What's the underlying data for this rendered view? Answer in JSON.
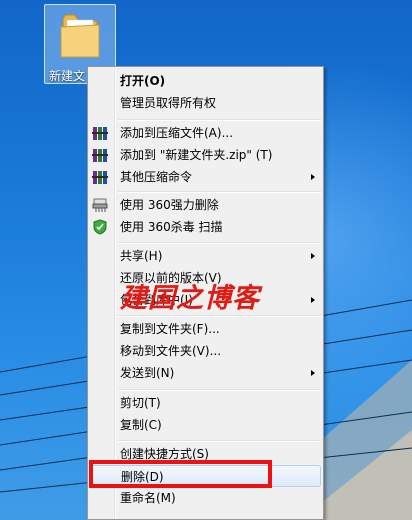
{
  "desktop": {
    "icon_label": "新建文"
  },
  "menu": {
    "items": [
      {
        "label": "打开(O)",
        "bold": true
      },
      {
        "label": "管理员取得所有权"
      },
      {
        "label": "添加到压缩文件(A)...",
        "icon": "winrar-icon"
      },
      {
        "label": "添加到 \"新建文件夹.zip\" (T)",
        "icon": "winrar-icon"
      },
      {
        "label": "其他压缩命令",
        "icon": "winrar-icon",
        "submenu": true
      },
      {
        "label": "使用 360强力删除",
        "icon": "shredder-icon"
      },
      {
        "label": "使用 360杀毒 扫描",
        "icon": "shield-icon"
      },
      {
        "label": "共享(H)",
        "submenu": true
      },
      {
        "label": "还原以前的版本(V)"
      },
      {
        "label": "包含到库中(I)",
        "submenu": true
      },
      {
        "label": "复制到文件夹(F)..."
      },
      {
        "label": "移动到文件夹(V)..."
      },
      {
        "label": "发送到(N)",
        "submenu": true
      },
      {
        "label": "剪切(T)"
      },
      {
        "label": "复制(C)"
      },
      {
        "label": "创建快捷方式(S)"
      },
      {
        "label": "删除(D)",
        "highlighted": true
      },
      {
        "label": "重命名(M)"
      }
    ]
  },
  "watermark": {
    "text": "建国之博客",
    "color": "#e11b14"
  },
  "annotation": {
    "box_color": "#ee1111"
  }
}
